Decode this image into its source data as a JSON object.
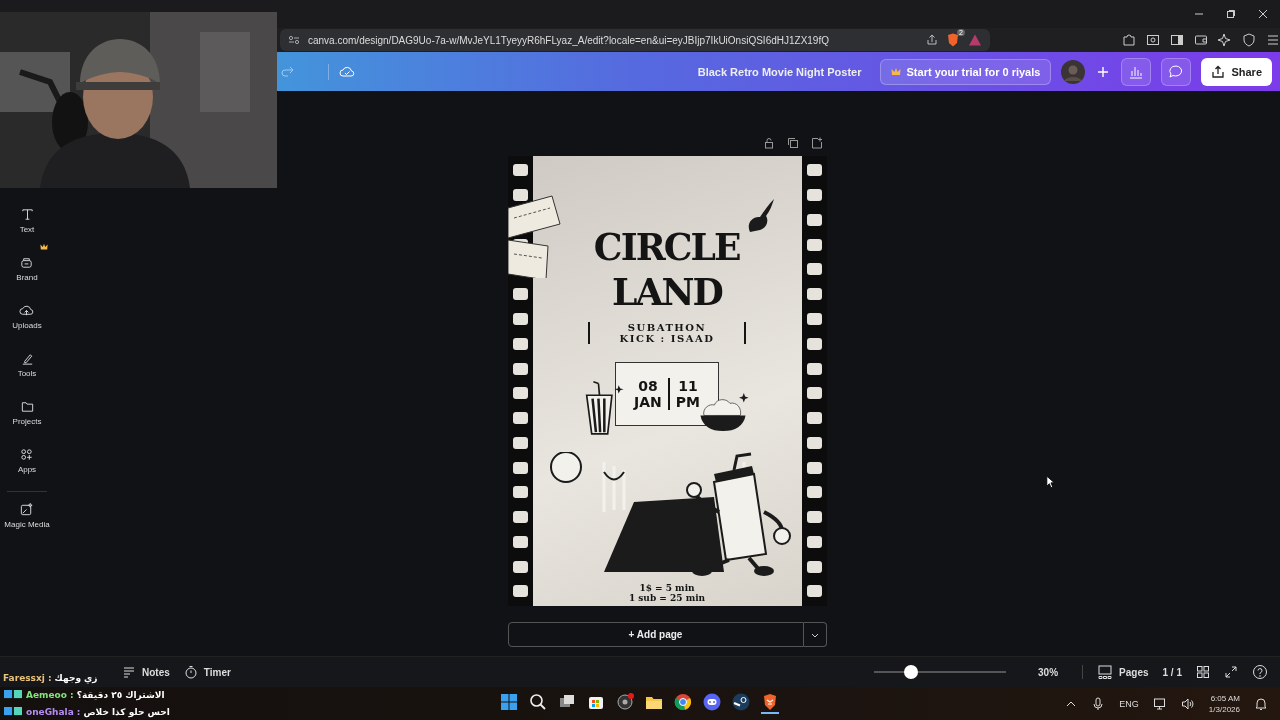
{
  "browser": {
    "url": "canva.com/design/DAG9Uo-7a-w/MvJeYL1TyeyyR6hFLyaz_A/edit?locale=en&ui=eyJBIjp7IkUiOnsiQSI6dHJ1ZX19fQ",
    "shield_badge": "2"
  },
  "header": {
    "title": "Black Retro Movie Night Poster",
    "trial_button": "Start your trial for 0 riyals",
    "share_button": "Share"
  },
  "sidebar": [
    {
      "label": "Text",
      "kind": "text",
      "premium": false
    },
    {
      "label": "Brand",
      "kind": "brand",
      "premium": true
    },
    {
      "label": "Uploads",
      "kind": "uploads",
      "premium": false
    },
    {
      "label": "Tools",
      "kind": "tools",
      "premium": false
    },
    {
      "label": "Projects",
      "kind": "projects",
      "premium": false
    },
    {
      "label": "Apps",
      "kind": "apps",
      "premium": false
    },
    {
      "label": "Magic Media",
      "kind": "magic",
      "premium": false
    }
  ],
  "poster": {
    "title_lines": [
      "CIRCLE",
      "LAND"
    ],
    "subtitle_lines": [
      "SUBATHON",
      "KICK : ISAAD"
    ],
    "date": [
      "08",
      "JAN"
    ],
    "time": [
      "11",
      "PM"
    ],
    "prices": [
      "1$ = 5 min",
      "1 sub = 25 min"
    ]
  },
  "add_page": "+ Add page",
  "footer": {
    "notes": "Notes",
    "timer": "Timer",
    "zoom": {
      "level": 0.3,
      "reading": "30%"
    },
    "pages": "Pages",
    "page_count": "1 / 1"
  },
  "chat": [
    {
      "user": "Faressxj :",
      "message": "زي وجهك",
      "color": "#e9c27b",
      "badges": false
    },
    {
      "user": "Aemeoo :",
      "message": "الاشتراك ٢٥ دقيقة؟",
      "color": "#84e27e",
      "badges": true
    },
    {
      "user": "oneGhala :",
      "message": "احس حلو كذا خلاص",
      "color": "#b58cf3",
      "badges": true
    }
  ],
  "taskbar": {
    "language": "ENG",
    "time": "6:05 AM",
    "date": "1/3/2026"
  }
}
